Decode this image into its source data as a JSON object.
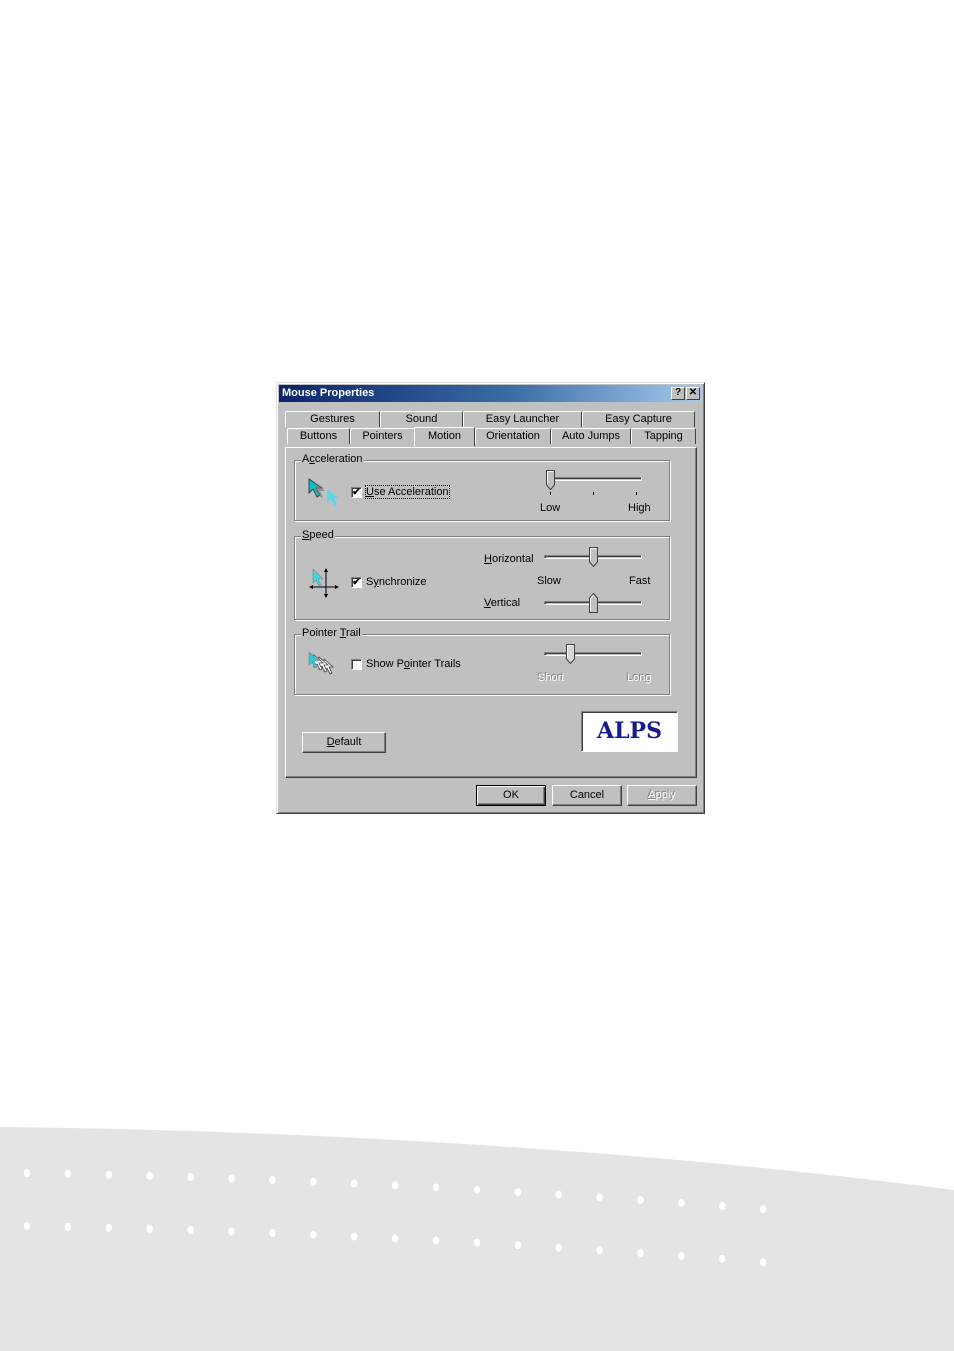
{
  "dialog": {
    "title": "Mouse Properties",
    "help_button": "?",
    "close_button": "✕",
    "tabs_row_back": [
      "Gestures",
      "Sound",
      "Easy Launcher",
      "Easy Capture"
    ],
    "tabs_row_front": [
      "Buttons",
      "Pointers",
      "Motion",
      "Orientation",
      "Auto Jumps",
      "Tapping"
    ],
    "active_tab": "Motion"
  },
  "acceleration": {
    "group_label_pre": "A",
    "group_label_ul": "c",
    "group_label_post": "celeration",
    "checkbox_checked": true,
    "checkbox_mark": "✔",
    "checkbox_label_ul": "U",
    "checkbox_label_post": "se Acceleration",
    "slider_value": 0.0,
    "slider_min_label": "Low",
    "slider_max_label": "High"
  },
  "speed": {
    "group_label_ul": "S",
    "group_label_post": "peed",
    "checkbox_checked": true,
    "checkbox_mark": "✔",
    "checkbox_label_pre": "S",
    "checkbox_label_ul": "y",
    "checkbox_label_post": "nchronize",
    "horizontal_label_ul": "H",
    "horizontal_label_post": "orizontal",
    "horizontal_value": 0.5,
    "vertical_label_ul": "V",
    "vertical_label_post": "ertical",
    "vertical_value": 0.5,
    "slow_label": "Slow",
    "fast_label": "Fast"
  },
  "pointer_trail": {
    "group_label_pre": "Pointer ",
    "group_label_ul": "T",
    "group_label_post": "rail",
    "checkbox_checked": false,
    "checkbox_label_pre": "Show P",
    "checkbox_label_ul": "o",
    "checkbox_label_post": "inter Trails",
    "slider_value": 0.25,
    "slider_enabled": false,
    "short_label": "Short",
    "long_label": "Long"
  },
  "default_button": {
    "ul": "D",
    "post": "efault"
  },
  "logo": {
    "text": "ALPS",
    "color": "#1a1a8c"
  },
  "footer": {
    "ok": "OK",
    "cancel": "Cancel",
    "apply_ul": "A",
    "apply_post": "pply",
    "apply_enabled": false
  }
}
